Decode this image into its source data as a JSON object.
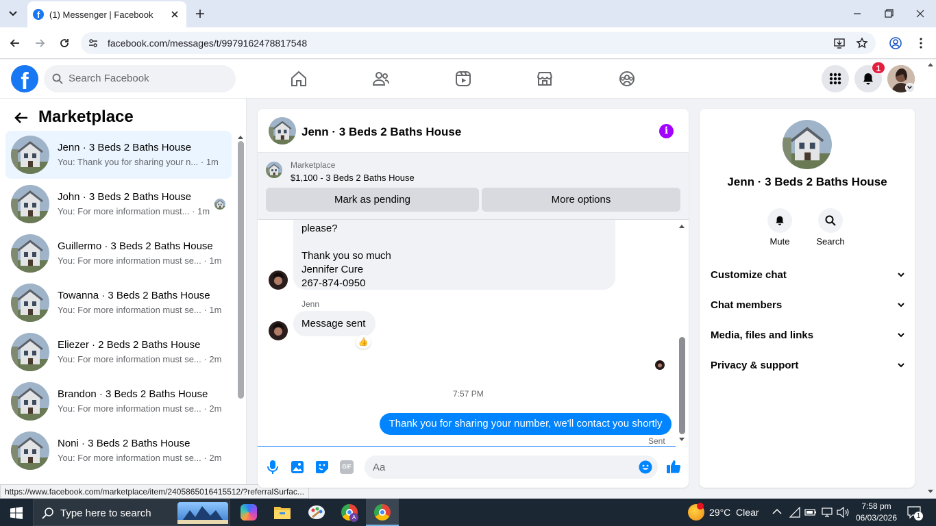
{
  "browser": {
    "tab_title": "(1) Messenger | Facebook",
    "url": "facebook.com/messages/t/9979162478817548",
    "status_url": "https://www.facebook.com/marketplace/item/2405865016415512/?referralSurfac..."
  },
  "fb": {
    "search_placeholder": "Search Facebook",
    "notification_count": "1",
    "brand_color": "#1877f2"
  },
  "left": {
    "title": "Marketplace",
    "conversations": [
      {
        "name": "Jenn · 3 Beds 2 Baths House",
        "snippet": "You: Thank you for sharing your n...",
        "time": "· 1m"
      },
      {
        "name": "John · 3 Beds 2 Baths House",
        "snippet": "You: For more information must...",
        "time": "· 1m"
      },
      {
        "name": "Guillermo · 3 Beds 2 Baths House",
        "snippet": "You: For more information must se...",
        "time": "· 1m"
      },
      {
        "name": "Towanna · 3 Beds 2 Baths House",
        "snippet": "You: For more information must se...",
        "time": "· 1m"
      },
      {
        "name": "Eliezer · 2 Beds 2 Baths House",
        "snippet": "You: For more information must se...",
        "time": "· 2m"
      },
      {
        "name": "Brandon · 3 Beds 2 Baths House",
        "snippet": "You: For more information must se...",
        "time": "· 2m"
      },
      {
        "name": "Noni · 3 Beds 2 Baths House",
        "snippet": "You: For more information must se...",
        "time": "· 2m"
      }
    ]
  },
  "chat": {
    "title": "Jenn · 3 Beds 2 Baths House",
    "listing": {
      "label": "Marketplace",
      "price_title": "$1,100 - 3 Beds 2 Baths House",
      "mark_pending": "Mark as pending",
      "more_options": "More options"
    },
    "msg1_lines": [
      "please?",
      "",
      "Thank you so much",
      "Jennifer Cure",
      "267-874-0950"
    ],
    "sender": "Jenn",
    "msg2": "Message sent",
    "reaction": "👍",
    "timestamp": "7:57 PM",
    "my_msg": "Thank you for sharing your number, we'll contact you shortly",
    "sent_status": "Sent",
    "composer_placeholder": "Aa",
    "accent_color": "#0084ff"
  },
  "info": {
    "name": "Jenn · 3 Beds 2 Baths House",
    "mute": "Mute",
    "search": "Search",
    "sections": [
      "Customize chat",
      "Chat members",
      "Media, files and links",
      "Privacy & support"
    ]
  },
  "taskbar": {
    "search_placeholder": "Type here to search",
    "weather": "29°C  Clear",
    "time": "7:58 pm",
    "date": "06/03/2026",
    "notif_count": "1"
  }
}
